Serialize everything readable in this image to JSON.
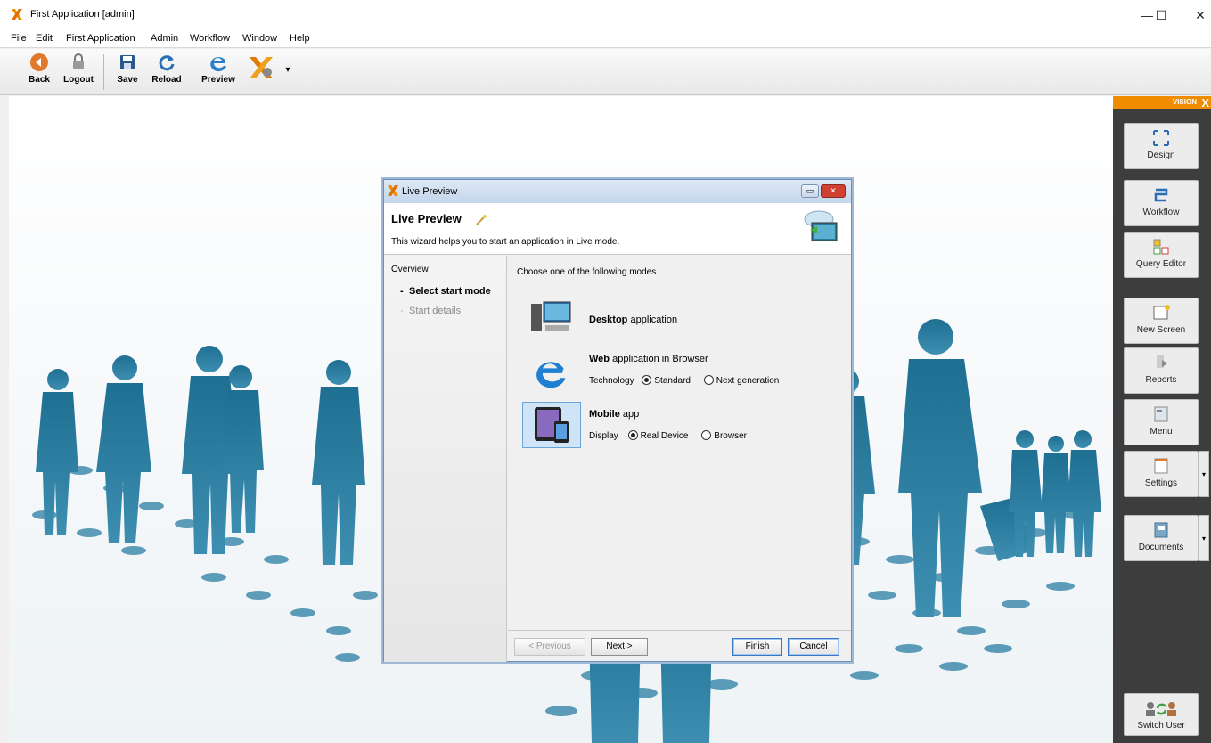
{
  "window": {
    "title": "First Application [admin]",
    "minimize": "—",
    "maximize": "☐",
    "close": "✕"
  },
  "menu": [
    "File",
    "Edit",
    "First Application",
    "Admin",
    "Workflow",
    "Window",
    "Help"
  ],
  "toolbar": {
    "back": "Back",
    "logout": "Logout",
    "save": "Save",
    "reload": "Reload",
    "preview": "Preview",
    "more": "▾"
  },
  "right_panel": {
    "brand": "VISION",
    "brand_x": "X",
    "buttons": [
      {
        "label": "Design",
        "icon": "design-icon"
      },
      {
        "label": "Workflow",
        "icon": "workflow-icon"
      },
      {
        "label": "Query Editor",
        "icon": "query-editor-icon"
      },
      {
        "label": "New Screen",
        "icon": "new-screen-icon"
      },
      {
        "label": "Reports",
        "icon": "reports-icon"
      },
      {
        "label": "Menu",
        "icon": "menu-icon"
      },
      {
        "label": "Settings",
        "icon": "settings-icon"
      },
      {
        "label": "Documents",
        "icon": "documents-icon"
      },
      {
        "label": "Switch User",
        "icon": "switch-user-icon"
      }
    ],
    "dropdown": "▾"
  },
  "dialog": {
    "title": "Live Preview",
    "heading": "Live Preview",
    "description": "This wizard helps you to start an application in Live mode.",
    "nav": {
      "overview": "Overview",
      "step1": "Select start mode",
      "step2": "Start details",
      "bullet": "-",
      "bullet2": "·"
    },
    "instruction": "Choose one of the following modes.",
    "options": {
      "desktop": {
        "bold": "Desktop",
        "rest": " application"
      },
      "web": {
        "bold": "Web",
        "rest": " application in Browser",
        "tech_label": "Technology",
        "choices": [
          "Standard",
          "Next generation"
        ],
        "selected": "Standard"
      },
      "mobile": {
        "bold": "Mobile",
        "rest": " app",
        "display_label": "Display",
        "choices": [
          "Real Device",
          "Browser"
        ],
        "selected": "Real Device"
      }
    },
    "buttons": {
      "previous": "< Previous",
      "next": "Next >",
      "finish": "Finish",
      "cancel": "Cancel"
    }
  },
  "colors": {
    "accent": "#f08c00",
    "silhouette": "#1f6f92",
    "panel": "#3d3d3d"
  }
}
